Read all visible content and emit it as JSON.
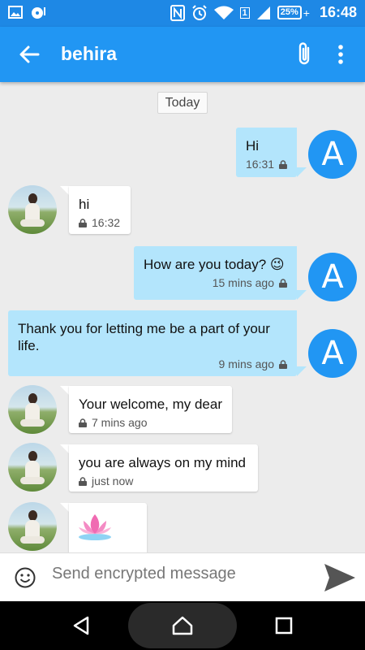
{
  "status_bar": {
    "time": "16:48",
    "battery_percent": "25%",
    "sim_slot": "1"
  },
  "app_bar": {
    "title": "behira"
  },
  "chat": {
    "day_label": "Today",
    "messages": [
      {
        "side": "out",
        "text": "Hi",
        "time": "16:31",
        "avatar_letter": "A"
      },
      {
        "side": "in",
        "text": "hi",
        "time": "16:32"
      },
      {
        "side": "out",
        "text": "How are you today? 😉",
        "time": "15 mins ago",
        "avatar_letter": "A"
      },
      {
        "side": "out",
        "text": "Thank you for letting me be a part of your life.",
        "time": "9 mins ago",
        "avatar_letter": "A"
      },
      {
        "side": "in",
        "text": "Your welcome, my dear",
        "time": "7 mins ago"
      },
      {
        "side": "in",
        "text": "you are always on my mind",
        "time": "just now"
      },
      {
        "side": "in",
        "text": "",
        "sticker": "lotus"
      }
    ]
  },
  "compose": {
    "placeholder": "Send encrypted message"
  },
  "colors": {
    "status_bar": "#1e88e5",
    "app_bar": "#2196f3",
    "outgoing_bubble": "#b3e5fc",
    "incoming_bubble": "#ffffff",
    "avatar_letter_bg": "#2196f3",
    "chat_bg": "#ececec"
  },
  "icons": {
    "back": "arrow-left-icon",
    "attach": "paperclip-icon",
    "menu": "more-vert-icon",
    "emoji": "smiley-icon",
    "send": "send-icon",
    "lock": "lock-icon"
  }
}
